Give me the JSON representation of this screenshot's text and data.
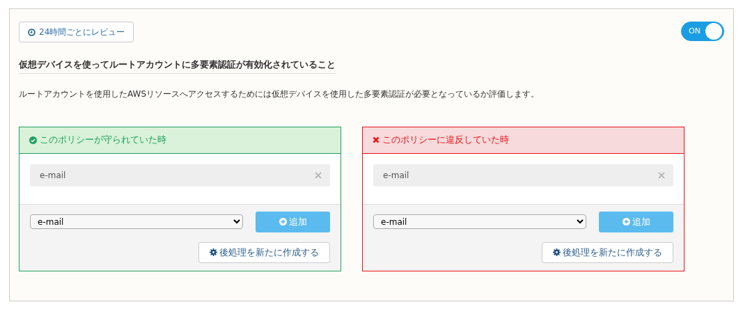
{
  "review_button": {
    "label": "24時間ごとにレビュー"
  },
  "toggle": {
    "label": "ON",
    "on": true
  },
  "title": "仮想デバイスを使ってルートアカウントに多要素認証が有効化されていること",
  "description": "ルートアカウントを使用したAWSリソースへアクセスするためには仮想デバイスを使用した多要素認証が必要となっているか評価します。",
  "panels": [
    {
      "kind": "compliant",
      "header": "このポリシーが守られていた時",
      "tags": [
        {
          "label": "e-mail"
        }
      ],
      "select": {
        "value": "e-mail"
      },
      "add_button": "追加",
      "create_button": "後処理を新たに作成する"
    },
    {
      "kind": "violation",
      "header": "このポリシーに違反していた時",
      "tags": [
        {
          "label": "e-mail"
        }
      ],
      "select": {
        "value": "e-mail"
      },
      "add_button": "追加",
      "create_button": "後処理を新たに作成する"
    }
  ]
}
